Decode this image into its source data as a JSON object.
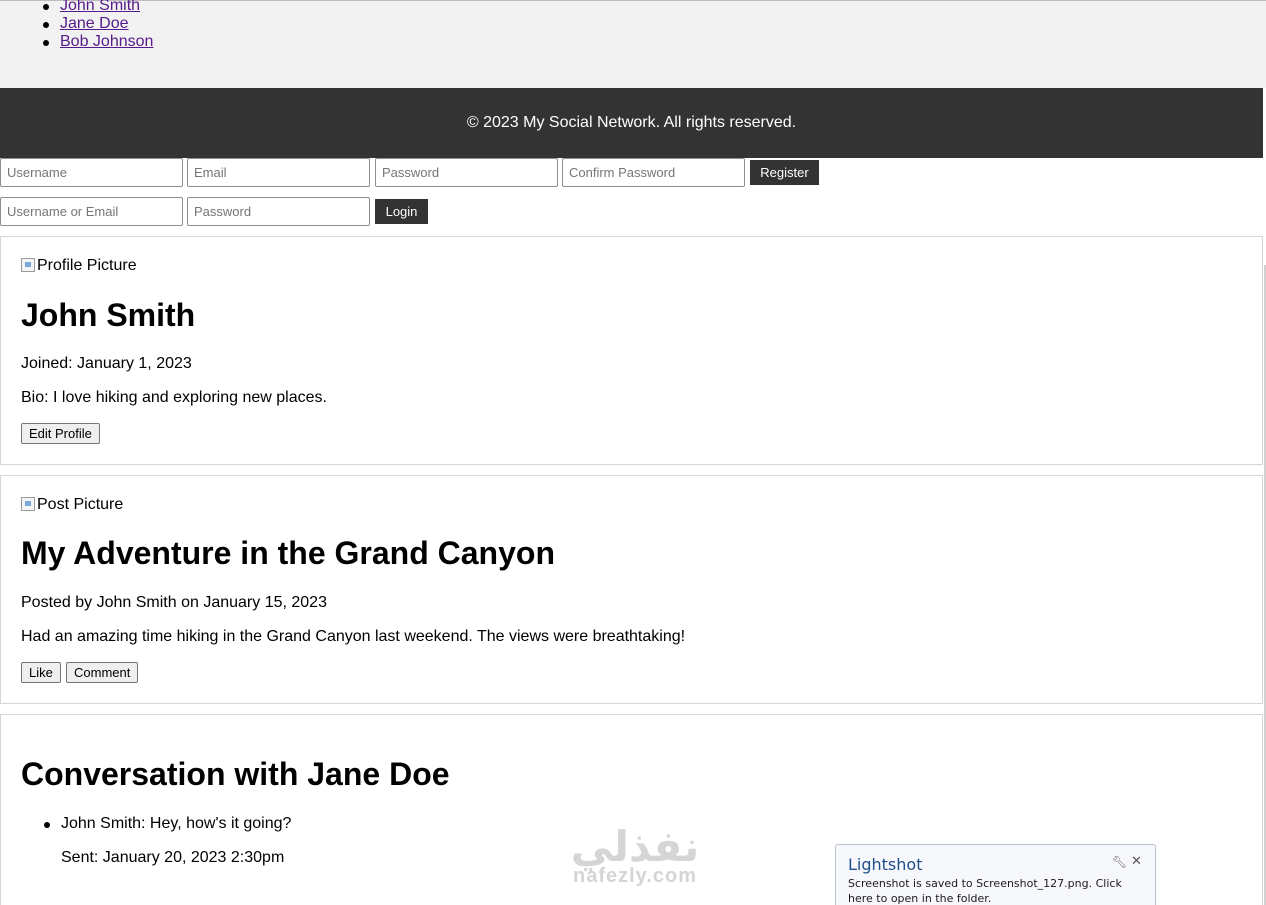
{
  "friends": [
    "John Smith",
    "Jane Doe",
    "Bob Johnson"
  ],
  "footer": {
    "copyright": "© 2023 My Social Network. All rights reserved."
  },
  "register_form": {
    "username_placeholder": "Username",
    "email_placeholder": "Email",
    "password_placeholder": "Password",
    "confirm_placeholder": "Confirm Password",
    "submit_label": "Register"
  },
  "login_form": {
    "user_placeholder": "Username or Email",
    "password_placeholder": "Password",
    "submit_label": "Login"
  },
  "profile": {
    "image_alt": "Profile Picture",
    "name": "John Smith",
    "joined": "Joined: January 1, 2023",
    "bio": "Bio: I love hiking and exploring new places.",
    "edit_label": "Edit Profile"
  },
  "post": {
    "image_alt": "Post Picture",
    "title": "My Adventure in the Grand Canyon",
    "byline": "Posted by John Smith on January 15, 2023",
    "body": "Had an amazing time hiking in the Grand Canyon last weekend. The views were breathtaking!",
    "like_label": "Like",
    "comment_label": "Comment"
  },
  "conversation": {
    "title": "Conversation with Jane Doe",
    "messages": [
      {
        "text": "John Smith: Hey, how's it going?",
        "sent": "Sent: January 20, 2023 2:30pm"
      }
    ]
  },
  "watermark": {
    "arabic": "نفذلي",
    "latin": "nafezly.com"
  },
  "toast": {
    "title": "Lightshot",
    "message": "Screenshot is saved to Screenshot_127.png. Click here to open in the folder.",
    "tool_icon": "wrench-icon",
    "close_icon": "close-icon"
  }
}
